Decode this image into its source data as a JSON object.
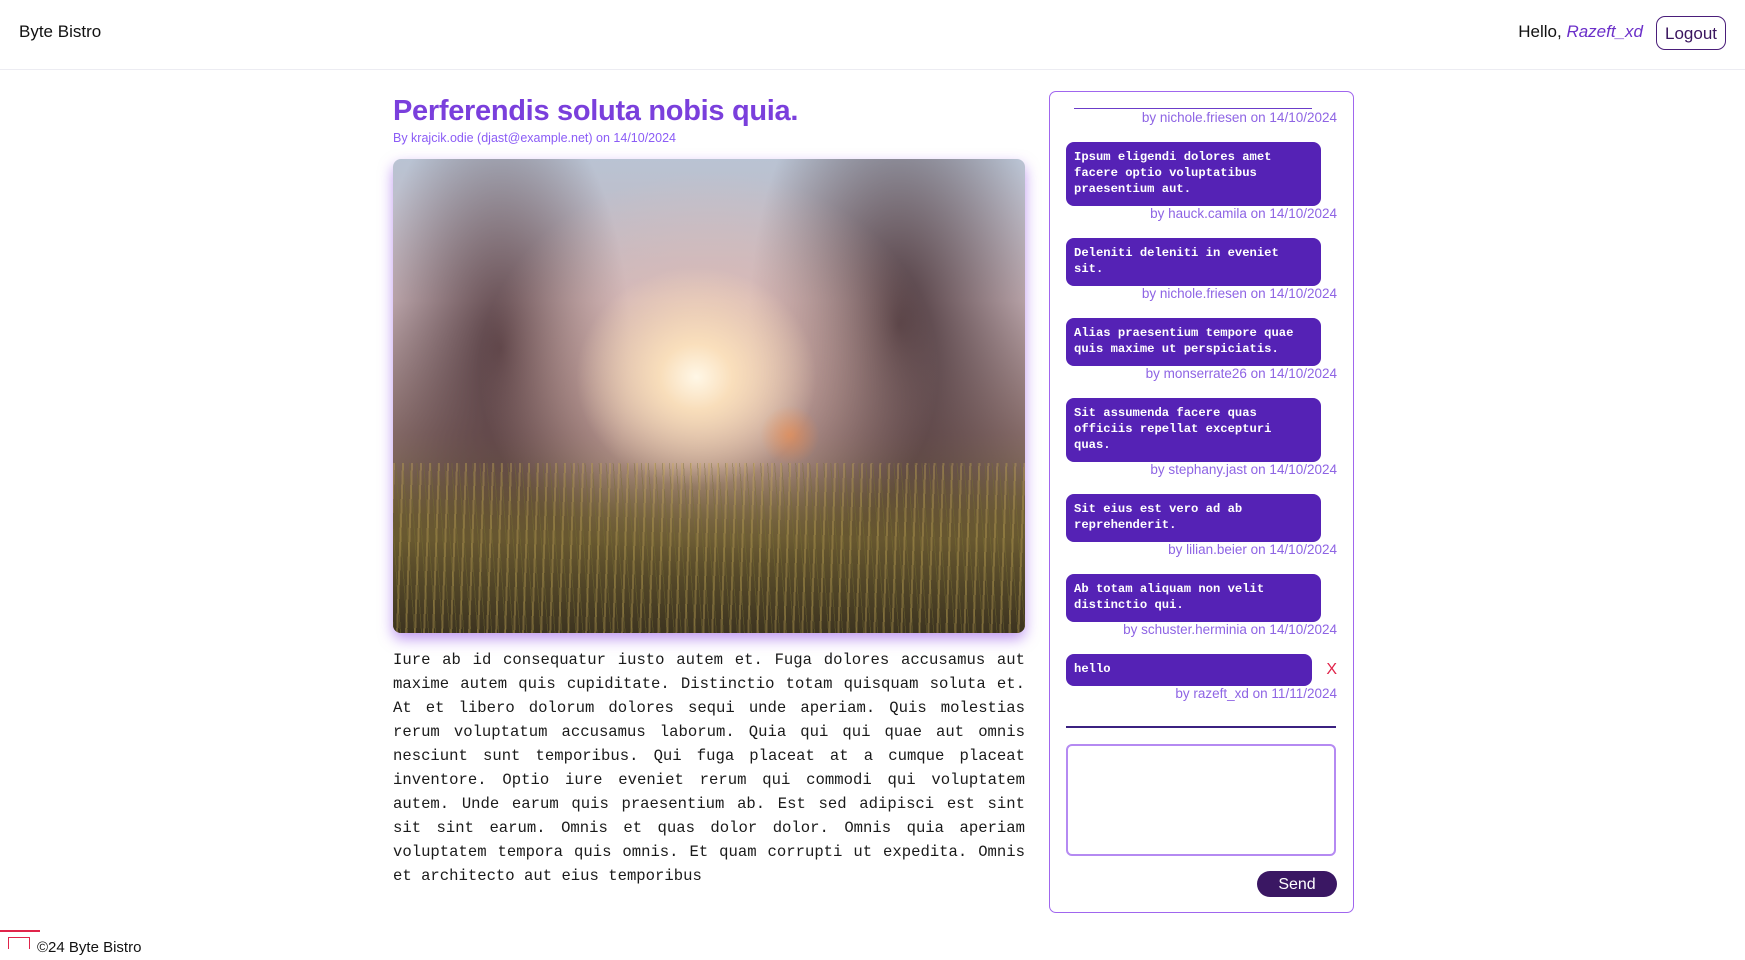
{
  "header": {
    "brand": "Byte Bistro",
    "greeting_prefix": "Hello, ",
    "username": "Razeft_xd",
    "logout_label": "Logout"
  },
  "article": {
    "title": "Perferendis soluta nobis quia.",
    "byline": "By krajcik.odie (djast@example.net) on 14/10/2024",
    "body": "Iure ab id consequatur iusto autem et. Fuga dolores accusamus aut maxime autem quis cupiditate. Distinctio totam quisquam soluta et. At et libero dolorum dolores sequi unde aperiam. Quis molestias rerum voluptatum accusamus laborum. Quia qui qui quae aut omnis nesciunt sunt temporibus. Qui fuga placeat at a cumque placeat inventore. Optio iure eveniet rerum qui commodi qui voluptatem autem. Unde earum quis praesentium ab. Est sed adipisci est sint sit sint earum. Omnis et quas dolor dolor. Omnis quia aperiam voluptatem tempora quis omnis. Et quam corrupti ut expedita. Omnis et architecto aut eius temporibus"
  },
  "chat": {
    "top_meta": "by nichole.friesen on 14/10/2024",
    "messages": [
      {
        "text": "Ipsum eligendi dolores amet facere optio voluptatibus praesentium aut.",
        "meta": "by hauck.camila on 14/10/2024"
      },
      {
        "text": "Deleniti deleniti in eveniet sit.",
        "meta": "by nichole.friesen on 14/10/2024"
      },
      {
        "text": "Alias praesentium tempore quae quis maxime ut perspiciatis.",
        "meta": "by monserrate26 on 14/10/2024"
      },
      {
        "text": "Sit assumenda facere quas officiis repellat excepturi quas.",
        "meta": "by stephany.jast on 14/10/2024"
      },
      {
        "text": "Sit eius est vero ad ab reprehenderit.",
        "meta": "by lilian.beier on 14/10/2024"
      },
      {
        "text": "Ab totam aliquam non velit distinctio qui.",
        "meta": "by schuster.herminia on 14/10/2024"
      },
      {
        "text": "hello",
        "meta": "by razeft_xd on 11/11/2024",
        "delete_label": "X"
      }
    ],
    "input_placeholder": "",
    "send_label": "Send"
  },
  "footer": {
    "text": "©24 Byte Bistro"
  },
  "colors": {
    "accent": "#7a3fdc",
    "bubble": "#5522b5",
    "send_button": "#3a1763",
    "delete": "#e0244a"
  }
}
